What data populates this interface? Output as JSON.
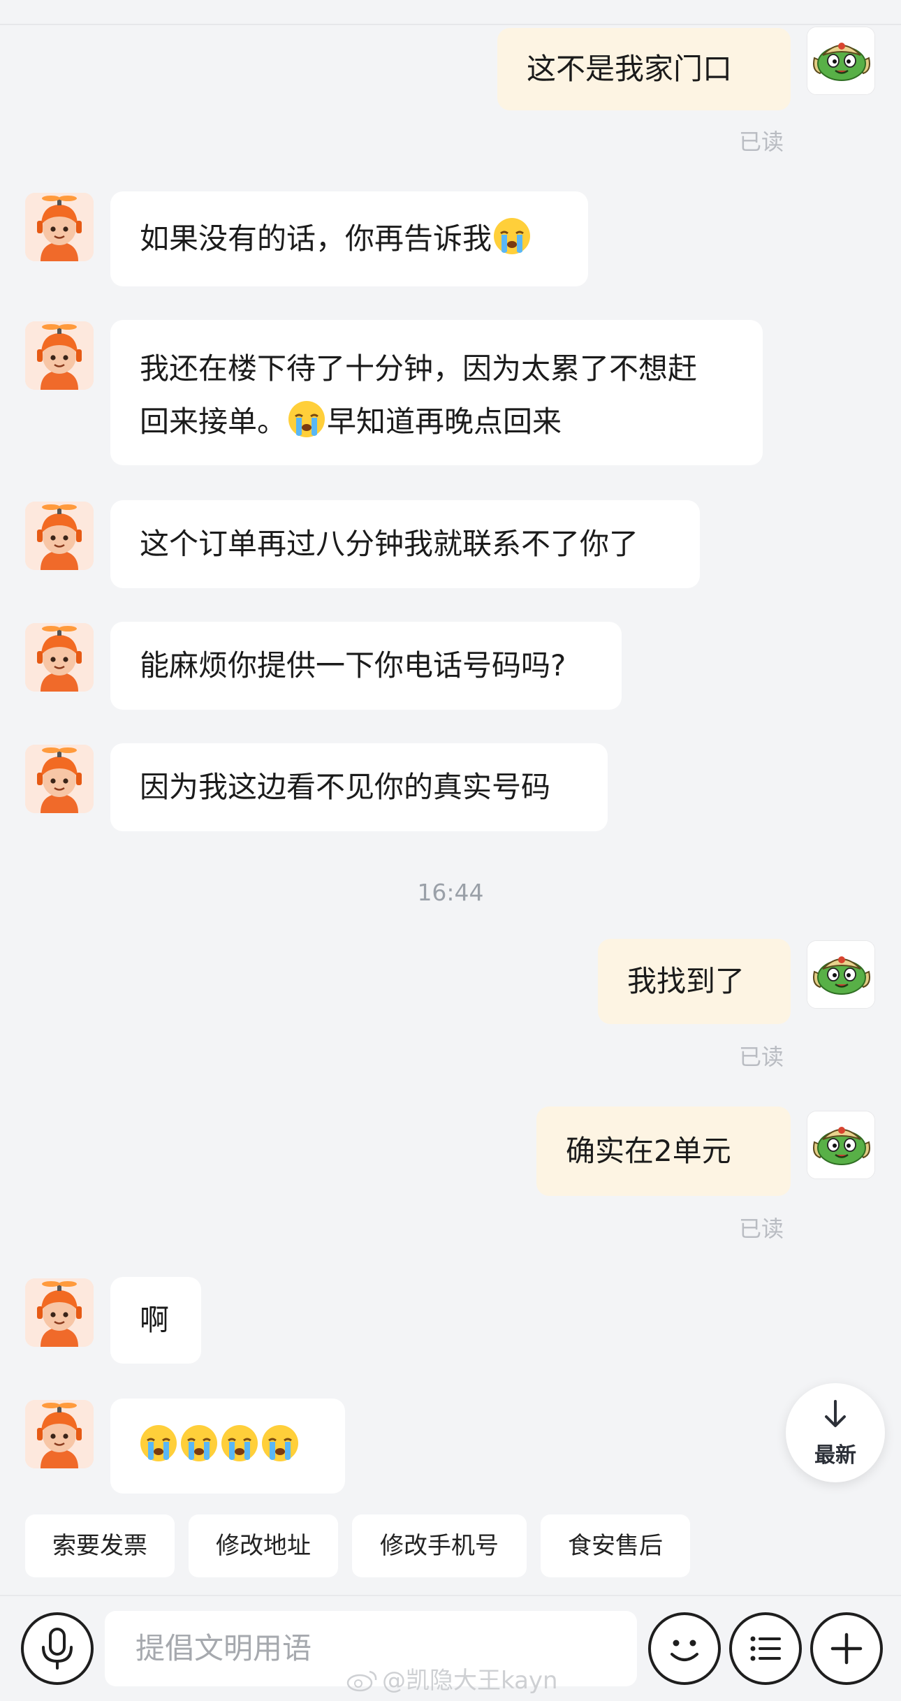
{
  "messages": {
    "m1": "这不是我家门口",
    "m1_read": "已读",
    "m2": "如果没有的话，你再告诉我",
    "m3_line1": "我还在楼下待了十分钟，因为太累了不想赶",
    "m3_line2a": "回来接单。",
    "m3_line2b": "早知道再晚点回来",
    "m4": "这个订单再过八分钟我就联系不了你了",
    "m5": "能麻烦你提供一下你电话号码吗?",
    "m6": "因为我这边看不见你的真实号码",
    "time": "16:44",
    "m7": "我找到了",
    "m7_read": "已读",
    "m8": "确实在2单元",
    "m8_read": "已读",
    "m9": "啊"
  },
  "latest_button": {
    "label": "最新",
    "icon": "arrow-down-icon"
  },
  "quick_actions": [
    "索要发票",
    "修改地址",
    "修改手机号",
    "食安售后"
  ],
  "input": {
    "placeholder": "提倡文明用语"
  },
  "icons": {
    "voice": "microphone-icon",
    "emoji": "smiley-icon",
    "menu": "list-icon",
    "add": "plus-icon",
    "crying": "crying-face-emoji"
  },
  "watermark": "@凯隐大王kayn",
  "colors": {
    "background": "#f3f4f6",
    "outgoing_bubble": "#fdf4e3",
    "incoming_bubble": "#ffffff",
    "read_text": "#b9bcc2"
  }
}
